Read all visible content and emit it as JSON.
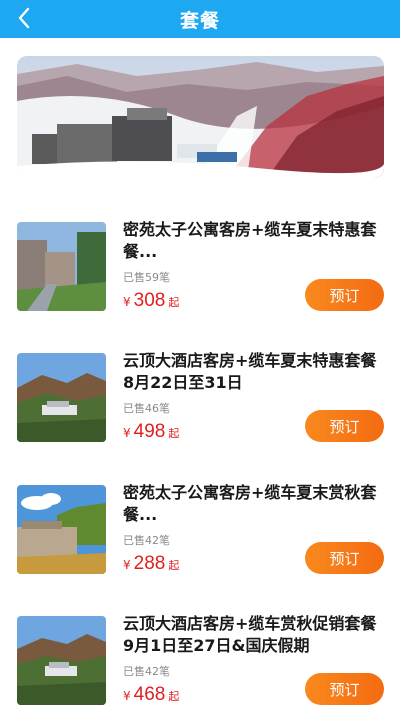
{
  "header": {
    "title": "套餐",
    "back_icon": "chevron-left-icon",
    "background": "#1ea8f2"
  },
  "packages": [
    {
      "title": "密苑太子公寓客房+缆车夏末特惠套餐...",
      "sold": "已售59笔",
      "currency": "¥",
      "price": "308",
      "suffix": "起",
      "button": "预订"
    },
    {
      "title": "云顶大酒店客房+缆车夏末特惠套餐 8月22日至31日",
      "sold": "已售46笔",
      "currency": "¥",
      "price": "498",
      "suffix": "起",
      "button": "预订"
    },
    {
      "title": "密苑太子公寓客房+缆车夏末赏秋套餐...",
      "sold": "已售42笔",
      "currency": "¥",
      "price": "288",
      "suffix": "起",
      "button": "预订"
    },
    {
      "title": "云顶大酒店客房+缆车赏秋促销套餐 9月1日至27日&国庆假期",
      "sold": "已售42笔",
      "currency": "¥",
      "price": "468",
      "suffix": "起",
      "button": "预订"
    }
  ],
  "colors": {
    "price": "#e02020",
    "button": "#f67a17",
    "sold": "#8a8a8a"
  }
}
